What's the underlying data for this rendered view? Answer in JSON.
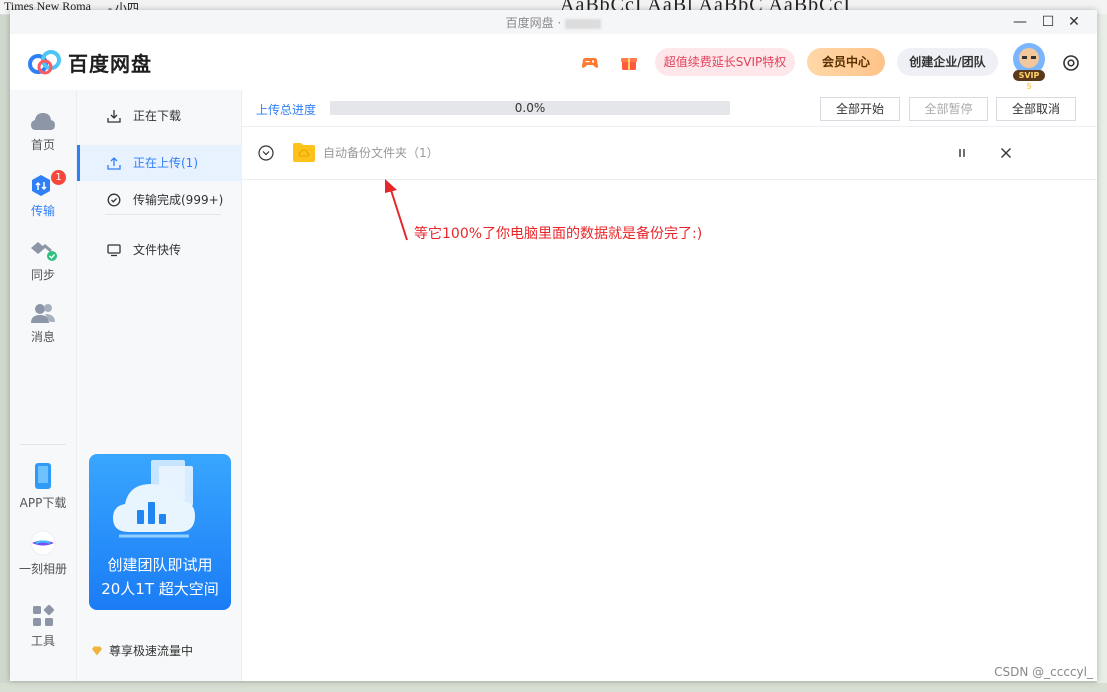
{
  "background": {
    "font_name": "Times New Roma",
    "font_size": "- 小四",
    "styles_preview": "AaBbCcI AaBl AaBbC AaBbCcI"
  },
  "window": {
    "title": "百度网盘 ·",
    "minimize_label": "—",
    "maximize_label": "☐",
    "close_label": "✕"
  },
  "header": {
    "app_name": "百度网盘",
    "promo_label": "超值续费延长SVIP特权",
    "vip_center_label": "会员中心",
    "team_label": "创建企业/团队",
    "avatar_badge": "SVIP 5"
  },
  "leftnav": {
    "items": [
      {
        "label": "首页",
        "icon": "cloud-icon"
      },
      {
        "label": "传输",
        "icon": "transfer-icon",
        "badge": "1"
      },
      {
        "label": "同步",
        "icon": "sync-icon"
      },
      {
        "label": "消息",
        "icon": "message-icon"
      }
    ],
    "bottom": [
      {
        "label": "APP下载",
        "icon": "phone-icon"
      },
      {
        "label": "一刻相册",
        "icon": "album-icon"
      },
      {
        "label": "工具",
        "icon": "tools-icon"
      }
    ]
  },
  "subnav": {
    "items": [
      {
        "label": "正在下载",
        "icon": "download-icon"
      },
      {
        "label": "正在上传(1)",
        "icon": "upload-icon"
      },
      {
        "label": "传输完成(999+)",
        "icon": "check-circle-icon"
      },
      {
        "label": "文件快传",
        "icon": "monitor-icon"
      }
    ],
    "promo_line1": "创建团队即试用",
    "promo_line2": "20人1T 超大空间",
    "speed_label": "尊享极速流量中"
  },
  "upload": {
    "progress_label": "上传总进度",
    "progress_text": "0.0%",
    "progress_value": 0.0,
    "start_all": "全部开始",
    "pause_all": "全部暂停",
    "cancel_all": "全部取消",
    "task_name": "自动备份文件夹（1）"
  },
  "annotation": "等它100%了你电脑里面的数据就是备份完了:)",
  "watermark": "CSDN @_ccccyl_",
  "colors": {
    "accent": "#2f7ff6",
    "annotation": "#e8262a",
    "promo_text": "#e4405a",
    "badge": "#f5483b"
  }
}
